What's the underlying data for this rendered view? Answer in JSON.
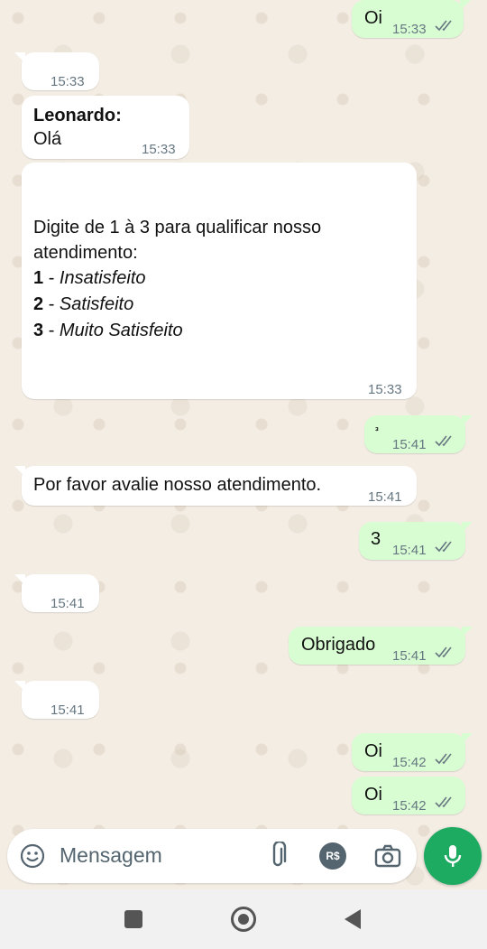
{
  "messages": [
    {
      "dir": "out",
      "text": "Oi",
      "time": "15:33"
    },
    {
      "dir": "in",
      "text": "",
      "time": "15:33"
    },
    {
      "dir": "in",
      "sender": "Leonardo:",
      "text": "Olá",
      "time": "15:33"
    },
    {
      "dir": "in",
      "intro_line1": "Digite de 1 à 3 para qualificar nosso",
      "intro_line2": "atendimento:",
      "options": [
        {
          "num": "1",
          "label": "Insatisfeito"
        },
        {
          "num": "2",
          "label": "Satisfeito"
        },
        {
          "num": "3",
          "label": "Muito Satisfeito"
        }
      ],
      "time": "15:33"
    },
    {
      "dir": "out",
      "text": "³",
      "time": "15:41"
    },
    {
      "dir": "in",
      "text": "Por favor avalie nosso atendimento.",
      "time": "15:41"
    },
    {
      "dir": "out",
      "text": "3",
      "time": "15:41"
    },
    {
      "dir": "in",
      "text": "",
      "time": "15:41"
    },
    {
      "dir": "out",
      "text": "Obrigado",
      "time": "15:41"
    },
    {
      "dir": "in",
      "text": "",
      "time": "15:41"
    },
    {
      "dir": "out",
      "text": "Oi",
      "time": "15:42"
    },
    {
      "dir": "out",
      "text": "Oi",
      "time": "15:42"
    }
  ],
  "separator": "-",
  "composer": {
    "placeholder": "Mensagem",
    "currency_label": "R$"
  },
  "icons": {
    "emoji": "emoji-icon",
    "attach": "paperclip-icon",
    "payment": "payment-icon",
    "camera": "camera-icon",
    "mic": "mic-icon",
    "read": "double-check-icon"
  },
  "colors": {
    "outgoing": "#d9fdd3",
    "incoming": "#ffffff",
    "accent": "#1daa61",
    "read_ticks": "#667781"
  }
}
